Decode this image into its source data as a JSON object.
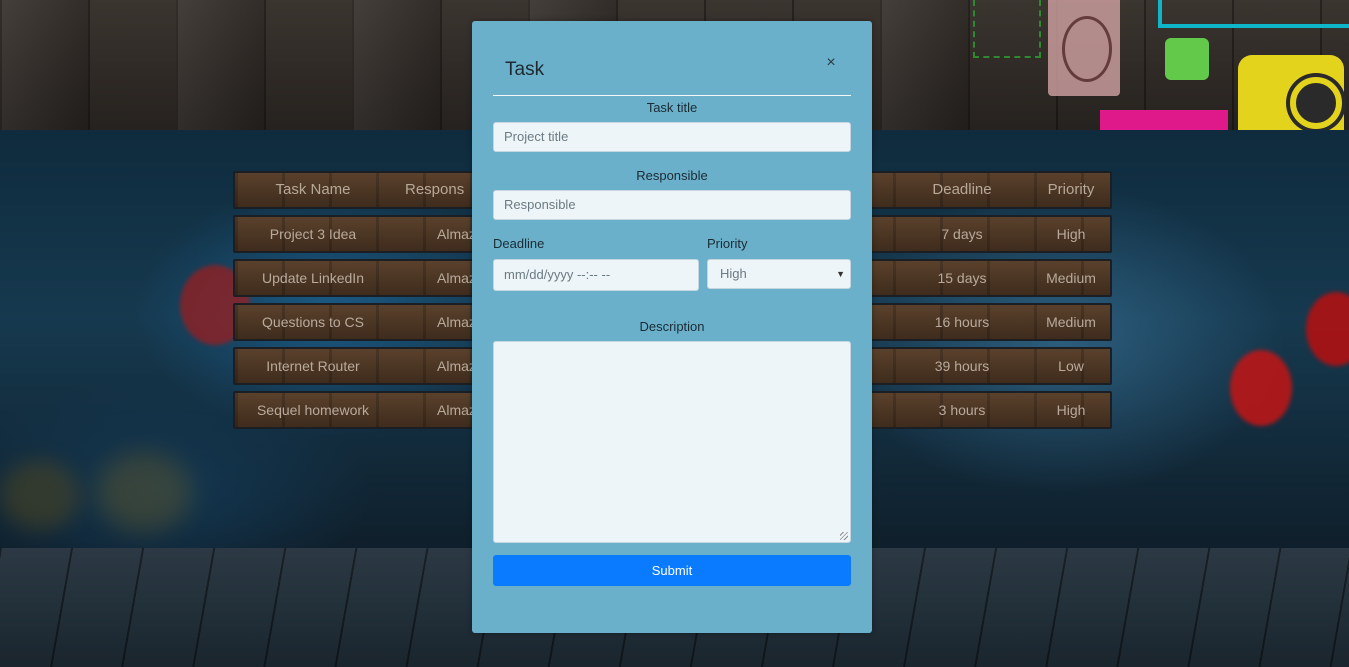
{
  "table": {
    "headers": {
      "name": "Task Name",
      "responsible": "Respons",
      "deadline": "Deadline",
      "priority": "Priority"
    },
    "rows": [
      {
        "name": "Project 3 Idea",
        "responsible": "Almaz",
        "deadline": "7 days",
        "priority": "High"
      },
      {
        "name": "Update LinkedIn",
        "responsible": "Almaz",
        "deadline": "15 days",
        "priority": "Medium"
      },
      {
        "name": "Questions to CS",
        "responsible": "Almaz",
        "deadline": "16 hours",
        "priority": "Medium"
      },
      {
        "name": "Internet Router",
        "responsible": "Almaz",
        "deadline": "39 hours",
        "priority": "Low"
      },
      {
        "name": "Sequel homework",
        "responsible": "Almaz",
        "deadline": "3 hours",
        "priority": "High"
      }
    ]
  },
  "modal": {
    "title": "Task",
    "close_icon": "×",
    "task_title_label": "Task title",
    "task_title_placeholder": "Project title",
    "responsible_label": "Responsible",
    "responsible_placeholder": "Responsible",
    "deadline_label": "Deadline",
    "deadline_placeholder": "mm/dd/yyyy --:-- --",
    "priority_label": "Priority",
    "priority_value": "High",
    "priority_arrow": "▼",
    "description_label": "Description",
    "submit_label": "Submit"
  },
  "colors": {
    "modal_bg": "#6ab0cb",
    "submit_bg": "#0a7bff",
    "input_bg": "#eef5f8"
  }
}
